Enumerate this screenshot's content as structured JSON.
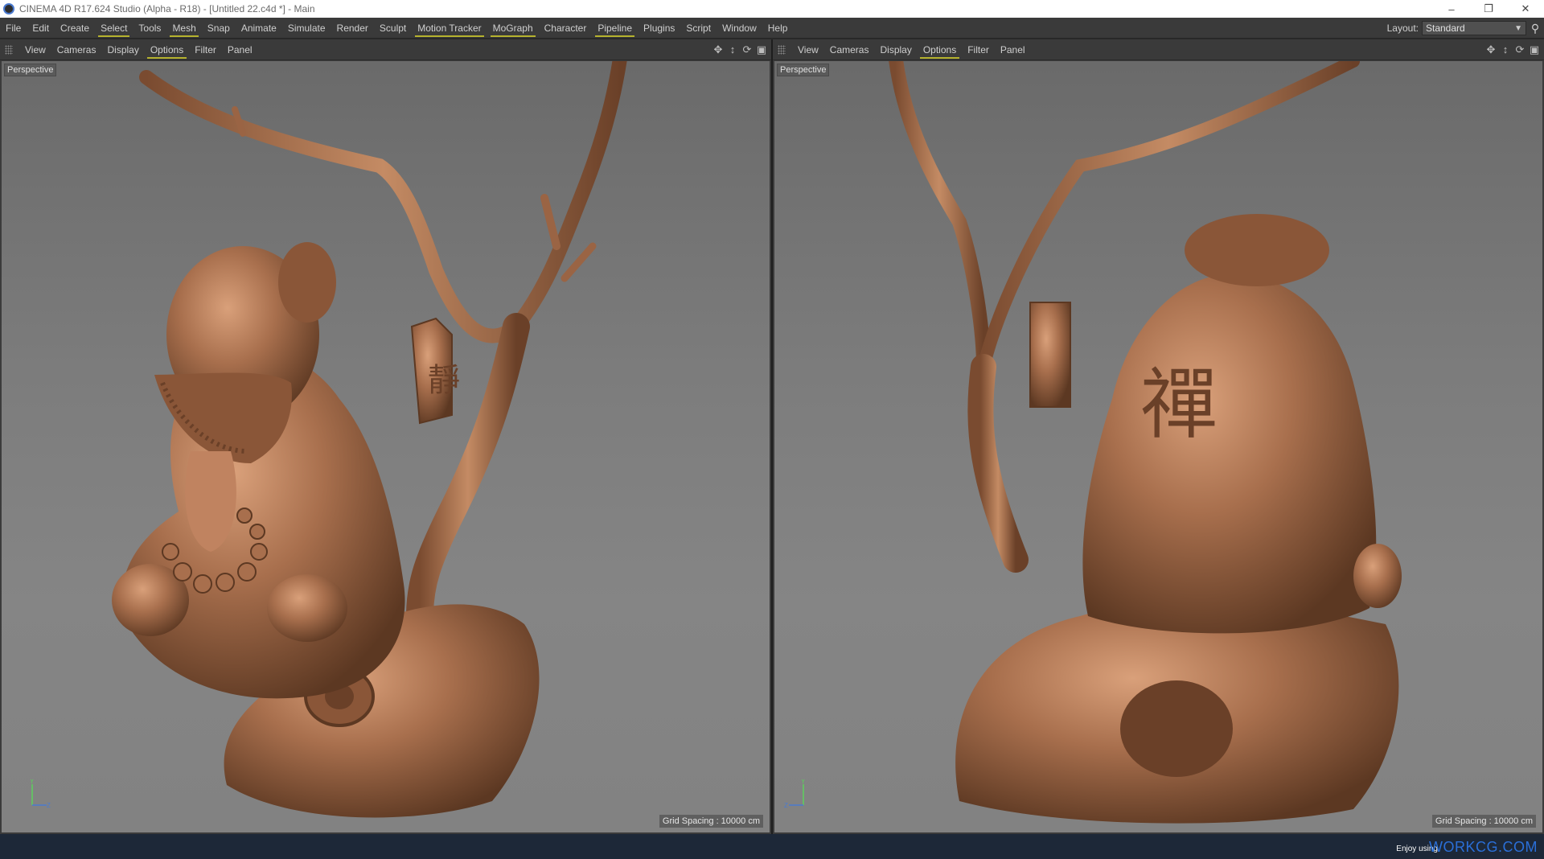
{
  "window": {
    "title": "CINEMA 4D R17.624 Studio (Alpha - R18) - [Untitled 22.c4d *] - Main",
    "controls": [
      "minimize-icon",
      "restore-icon",
      "close-icon"
    ]
  },
  "menubar": {
    "items": [
      "File",
      "Edit",
      "Create",
      "Select",
      "Tools",
      "Mesh",
      "Snap",
      "Animate",
      "Simulate",
      "Render",
      "Sculpt",
      "Motion Tracker",
      "MoGraph",
      "Character",
      "Pipeline",
      "Plugins",
      "Script",
      "Window",
      "Help"
    ],
    "underlined": [
      "Select",
      "Mesh",
      "Motion Tracker",
      "MoGraph",
      "Pipeline"
    ],
    "layout_label": "Layout:",
    "layout_value": "Standard"
  },
  "viewports": [
    {
      "menus": [
        "View",
        "Cameras",
        "Display",
        "Options",
        "Filter",
        "Panel"
      ],
      "active_menu": "Options",
      "label": "Perspective",
      "grid_spacing": "Grid Spacing : 10000 cm"
    },
    {
      "menus": [
        "View",
        "Cameras",
        "Display",
        "Options",
        "Filter",
        "Panel"
      ],
      "active_menu": "Options",
      "label": "Perspective",
      "grid_spacing": "Grid Spacing : 10000 cm"
    }
  ],
  "status": {
    "enjoy": "Enjoy using",
    "brand": "WORKCG.COM"
  },
  "colors": {
    "accent_underline": "#b5b22e",
    "bronze": "#a8704e",
    "brand": "#2a6fd8"
  }
}
